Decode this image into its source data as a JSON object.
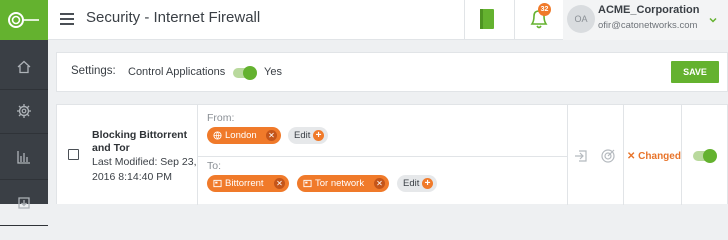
{
  "header": {
    "title": "Security - Internet Firewall",
    "notification_count": "32",
    "account": {
      "initials": "OA",
      "name": "ACME_Corporation",
      "email": "ofir@catonetworks.com"
    }
  },
  "sidebar": {
    "items": [
      {
        "icon": "home-icon"
      },
      {
        "icon": "gear-icon"
      },
      {
        "icon": "bar-chart-icon"
      },
      {
        "icon": "download-icon"
      }
    ]
  },
  "settings": {
    "label": "Settings:",
    "control_applications_label": "Control Applications",
    "control_applications_value": "Yes",
    "control_applications_enabled": true,
    "save_label": "SAVE"
  },
  "rule": {
    "name": "Blocking Bittorrent and Tor",
    "last_modified": "Last Modified: Sep 23, 2016 8:14:40 PM",
    "from_label": "From:",
    "from_items": [
      {
        "label": "London",
        "icon": "globe-icon"
      }
    ],
    "to_label": "To:",
    "to_items": [
      {
        "label": "Bittorrent",
        "icon": "app-icon"
      },
      {
        "label": "Tor network",
        "icon": "app-icon"
      }
    ],
    "edit_label": "Edit",
    "status": "Changed",
    "enabled": true
  },
  "colors": {
    "accent_green": "#64b22f",
    "accent_orange": "#f07a2a",
    "sidebar_bg": "#3a3f45"
  }
}
